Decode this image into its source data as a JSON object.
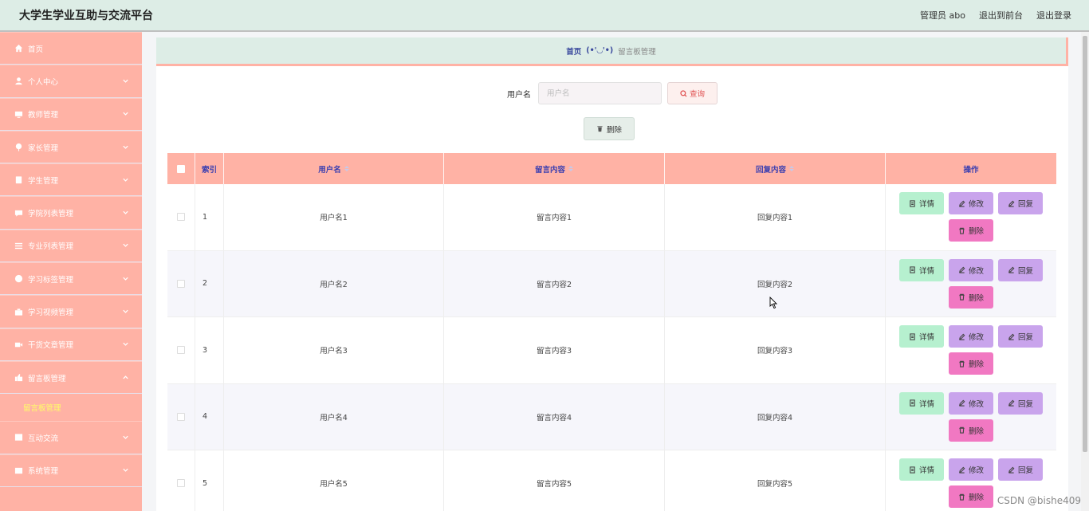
{
  "header": {
    "title": "大学生学业互助与交流平台",
    "admin_label": "管理员 abo",
    "back_label": "退出到前台",
    "logout_label": "退出登录"
  },
  "sidebar": {
    "items": [
      {
        "label": "首页",
        "icon": "home-icon"
      },
      {
        "label": "个人中心",
        "icon": "user-icon"
      },
      {
        "label": "教师管理",
        "icon": "monitor-icon"
      },
      {
        "label": "家长管理",
        "icon": "pin-icon"
      },
      {
        "label": "学生管理",
        "icon": "clipboard-icon"
      },
      {
        "label": "学院列表管理",
        "icon": "chat-icon"
      },
      {
        "label": "专业列表管理",
        "icon": "list-icon"
      },
      {
        "label": "学习标签管理",
        "icon": "gauge-icon"
      },
      {
        "label": "学习视频管理",
        "icon": "briefcase-icon"
      },
      {
        "label": "干货文章管理",
        "icon": "video-icon"
      },
      {
        "label": "留言板管理",
        "icon": "thumb-icon"
      },
      {
        "label": "互动交流",
        "icon": "chart-icon"
      },
      {
        "label": "系统管理",
        "icon": "window-icon"
      }
    ],
    "sub_active": "留言板管理"
  },
  "breadcrumb": {
    "home": "首页",
    "separator": "(•'◡'•)",
    "current": "留言板管理"
  },
  "search": {
    "label": "用户名",
    "placeholder": "用户名",
    "query_label": "查询"
  },
  "bulk_delete_label": "删除",
  "table": {
    "columns": {
      "index": "索引",
      "username": "用户名",
      "message": "留言内容",
      "reply": "回复内容",
      "ops": "操作"
    },
    "rows": [
      {
        "index": "1",
        "username": "用户名1",
        "message": "留言内容1",
        "reply": "回复内容1"
      },
      {
        "index": "2",
        "username": "用户名2",
        "message": "留言内容2",
        "reply": "回复内容2"
      },
      {
        "index": "3",
        "username": "用户名3",
        "message": "留言内容3",
        "reply": "回复内容3"
      },
      {
        "index": "4",
        "username": "用户名4",
        "message": "留言内容4",
        "reply": "回复内容4"
      },
      {
        "index": "5",
        "username": "用户名5",
        "message": "留言内容5",
        "reply": "回复内容5"
      }
    ],
    "ops": {
      "detail": "详情",
      "edit": "修改",
      "reply": "回复",
      "remove": "删除"
    }
  },
  "watermark": "CSDN @bishe409",
  "colors": {
    "sidebar": "#ffb2a5",
    "header": "#ddede6",
    "detail_btn": "#b6f0cf",
    "edit_btn": "#c9a4ec",
    "remove_btn": "#f178c2",
    "active_sub": "#ffff66"
  }
}
